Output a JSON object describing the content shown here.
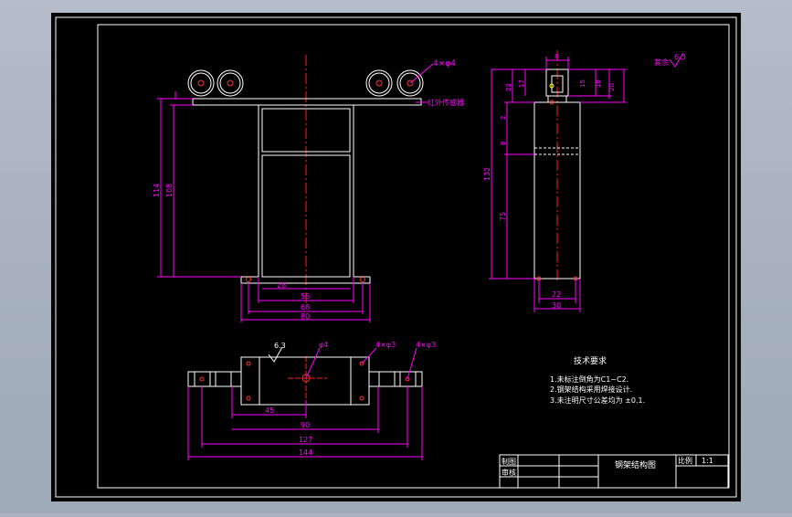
{
  "colors": {
    "background": "#a9b3c1",
    "sheet": "#000000",
    "frame": "#ffffff",
    "dimension": "#ff00ff",
    "centerline": "#ff2020",
    "outline": "#ffffff",
    "hole": "#ff3030",
    "accent_yellow": "#ffff00"
  },
  "front_view": {
    "callout_holes": "4×φ4",
    "callout_sensor": "红外传感器",
    "dim_overall_height": "114",
    "dim_inner_height": "108",
    "dim_slot": "28",
    "dim_56": "56",
    "dim_68": "68",
    "dim_80": "80"
  },
  "side_view": {
    "dim_top_width": "8",
    "dim_22": "22",
    "dim_17": "17",
    "dim_15": "15",
    "dim_18": "18",
    "dim_20": "20",
    "dim_2": "2",
    "dim_8": "8",
    "dim_132": "132",
    "dim_75": "75",
    "dim_22b": "22",
    "dim_30": "30"
  },
  "top_view": {
    "roughness": "6.3",
    "callout_center": "φ4",
    "callout_holes_a": "4×φ3",
    "callout_holes_b": "4×φ3",
    "dim_45": "45",
    "dim_90": "90",
    "dim_127": "127",
    "dim_144": "144"
  },
  "roughness_note": {
    "label": "其余",
    "value": "6.3"
  },
  "notes": {
    "title": "技术要求",
    "items": [
      "1.未标注倒角为C1~C2.",
      "2.钢架结构采用焊接设计.",
      "3.未注明尺寸公差均为 ±0.1."
    ]
  },
  "title_block": {
    "drawn_label": "制图",
    "checked_label": "审核",
    "drawing_name": "钢架结构图",
    "scale_label": "比例",
    "scale_value": "1:1"
  }
}
